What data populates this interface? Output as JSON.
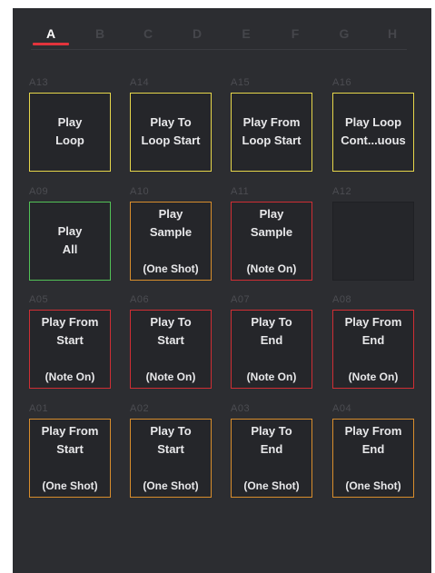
{
  "tabs": [
    {
      "label": "A",
      "active": true
    },
    {
      "label": "B",
      "active": false
    },
    {
      "label": "C",
      "active": false
    },
    {
      "label": "D",
      "active": false
    },
    {
      "label": "E",
      "active": false
    },
    {
      "label": "F",
      "active": false
    },
    {
      "label": "G",
      "active": false
    },
    {
      "label": "H",
      "active": false
    }
  ],
  "colors": {
    "accent_tab": "#e2343c",
    "yellow": "#e6d64a",
    "green": "#52c156",
    "red": "#cf2e34",
    "orange": "#d88d2c"
  },
  "pads": [
    {
      "id": "A13",
      "line1": "Play",
      "line2": "Loop",
      "sub": "",
      "color": "yellow"
    },
    {
      "id": "A14",
      "line1": "Play To",
      "line2": "Loop Start",
      "sub": "",
      "color": "yellow"
    },
    {
      "id": "A15",
      "line1": "Play From",
      "line2": "Loop Start",
      "sub": "",
      "color": "yellow"
    },
    {
      "id": "A16",
      "line1": "Play Loop",
      "line2": "Cont...uous",
      "sub": "",
      "color": "yellow"
    },
    {
      "id": "A09",
      "line1": "Play",
      "line2": "All",
      "sub": "",
      "color": "green"
    },
    {
      "id": "A10",
      "line1": "Play",
      "line2": "Sample",
      "sub": "(One Shot)",
      "color": "orange"
    },
    {
      "id": "A11",
      "line1": "Play",
      "line2": "Sample",
      "sub": "(Note On)",
      "color": "red"
    },
    {
      "id": "A12",
      "line1": "",
      "line2": "",
      "sub": "",
      "color": "empty"
    },
    {
      "id": "A05",
      "line1": "Play From",
      "line2": "Start",
      "sub": "(Note On)",
      "color": "red"
    },
    {
      "id": "A06",
      "line1": "Play To",
      "line2": "Start",
      "sub": "(Note On)",
      "color": "red"
    },
    {
      "id": "A07",
      "line1": "Play To",
      "line2": "End",
      "sub": "(Note On)",
      "color": "red"
    },
    {
      "id": "A08",
      "line1": "Play From",
      "line2": "End",
      "sub": "(Note On)",
      "color": "red"
    },
    {
      "id": "A01",
      "line1": "Play From",
      "line2": "Start",
      "sub": "(One Shot)",
      "color": "orange"
    },
    {
      "id": "A02",
      "line1": "Play To",
      "line2": "Start",
      "sub": "(One Shot)",
      "color": "orange"
    },
    {
      "id": "A03",
      "line1": "Play To",
      "line2": "End",
      "sub": "(One Shot)",
      "color": "orange"
    },
    {
      "id": "A04",
      "line1": "Play From",
      "line2": "End",
      "sub": "(One Shot)",
      "color": "orange"
    }
  ]
}
